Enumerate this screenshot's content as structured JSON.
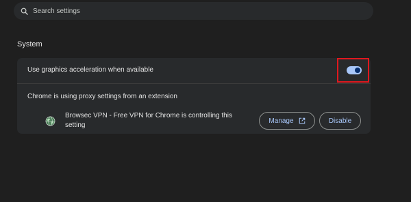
{
  "search": {
    "placeholder": "Search settings",
    "icon": "search-icon"
  },
  "section": {
    "title": "System"
  },
  "graphics_acceleration": {
    "label": "Use graphics acceleration when available",
    "enabled": true,
    "highlight_color": "#e0181e"
  },
  "proxy": {
    "title": "Chrome is using proxy settings from an extension",
    "extension_icon": "globe-icon",
    "extension_text": "Browsec VPN - Free VPN for Chrome is controlling this setting",
    "manage_label": "Manage",
    "manage_icon": "open-in-new-icon",
    "disable_label": "Disable"
  },
  "colors": {
    "background": "#1f1f1f",
    "card": "#282a2c",
    "accent": "#a8c7fa"
  }
}
